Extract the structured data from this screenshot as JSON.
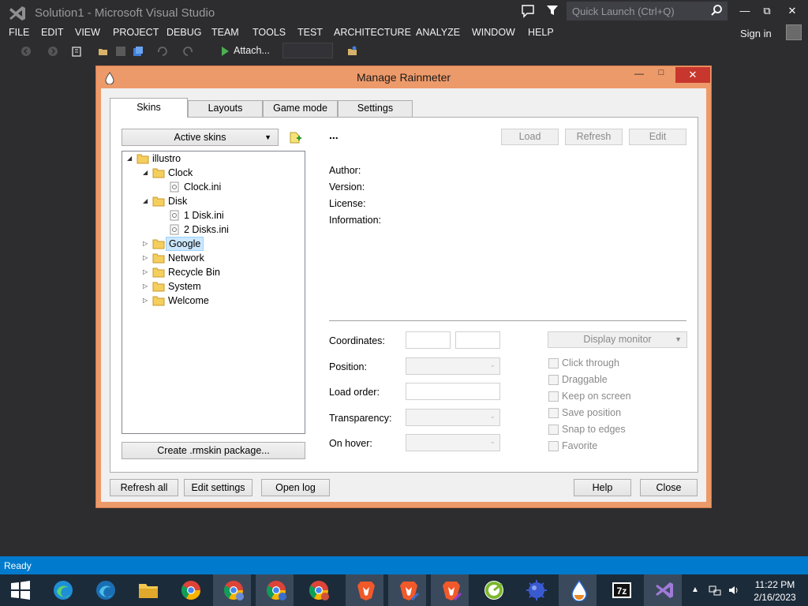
{
  "vs": {
    "title": "Solution1 - Microsoft Visual Studio",
    "quick_launch_placeholder": "Quick Launch (Ctrl+Q)",
    "menu": [
      "FILE",
      "EDIT",
      "VIEW",
      "PROJECT",
      "DEBUG",
      "TEAM",
      "TOOLS",
      "TEST",
      "ARCHITECTURE",
      "ANALYZE",
      "WINDOW",
      "HELP"
    ],
    "sign_in": "Sign in",
    "attach_label": "Attach...",
    "status": "Ready",
    "accent": "#007acc"
  },
  "dialog": {
    "title": "Manage Rainmeter",
    "tabs": [
      "Skins",
      "Layouts",
      "Game mode",
      "Settings"
    ],
    "active_tab": "Skins",
    "active_skins_label": "Active skins",
    "tree": [
      {
        "label": "illustro",
        "type": "folder",
        "expanded": true,
        "depth": 0
      },
      {
        "label": "Clock",
        "type": "folder",
        "expanded": true,
        "depth": 1
      },
      {
        "label": "Clock.ini",
        "type": "file",
        "depth": 2
      },
      {
        "label": "Disk",
        "type": "folder",
        "expanded": true,
        "depth": 1
      },
      {
        "label": "1 Disk.ini",
        "type": "file",
        "depth": 2
      },
      {
        "label": "2 Disks.ini",
        "type": "file",
        "depth": 2
      },
      {
        "label": "Google",
        "type": "folder",
        "expanded": false,
        "depth": 1,
        "selected": true
      },
      {
        "label": "Network",
        "type": "folder",
        "expanded": false,
        "depth": 1
      },
      {
        "label": "Recycle Bin",
        "type": "folder",
        "expanded": false,
        "depth": 1
      },
      {
        "label": "System",
        "type": "folder",
        "expanded": false,
        "depth": 1
      },
      {
        "label": "Welcome",
        "type": "folder",
        "expanded": false,
        "depth": 1
      }
    ],
    "create_package": "Create .rmskin package...",
    "skin_name": "...",
    "skin_buttons": [
      "Load",
      "Refresh",
      "Edit"
    ],
    "info_labels": [
      "Author:",
      "Version:",
      "License:",
      "Information:"
    ],
    "coordinates_label": "Coordinates:",
    "position_label": "Position:",
    "load_order_label": "Load order:",
    "transparency_label": "Transparency:",
    "on_hover_label": "On hover:",
    "display_monitor": "Display monitor",
    "checkboxes": [
      "Click through",
      "Draggable",
      "Keep on screen",
      "Save position",
      "Snap to edges",
      "Favorite"
    ],
    "bottom_left_buttons": [
      "Refresh all",
      "Edit settings",
      "Open log"
    ],
    "help_button": "Help",
    "close_button": "Close",
    "frame_color": "#ed9a6a"
  },
  "taskbar": {
    "time": "11:22 PM",
    "date": "2/16/2023",
    "apps": [
      "windows-start",
      "microsoft-edge",
      "microsoft-edge-beta",
      "file-explorer",
      "google-chrome",
      "google-chrome-profile-2",
      "google-chrome-profile-3",
      "google-chrome-profile-4",
      "brave-browser",
      "brave-browser-beta",
      "brave-browser-nightly",
      "greenshot",
      "rainmeter-skin-app",
      "rainmeter",
      "seven-zip",
      "visual-studio"
    ]
  }
}
